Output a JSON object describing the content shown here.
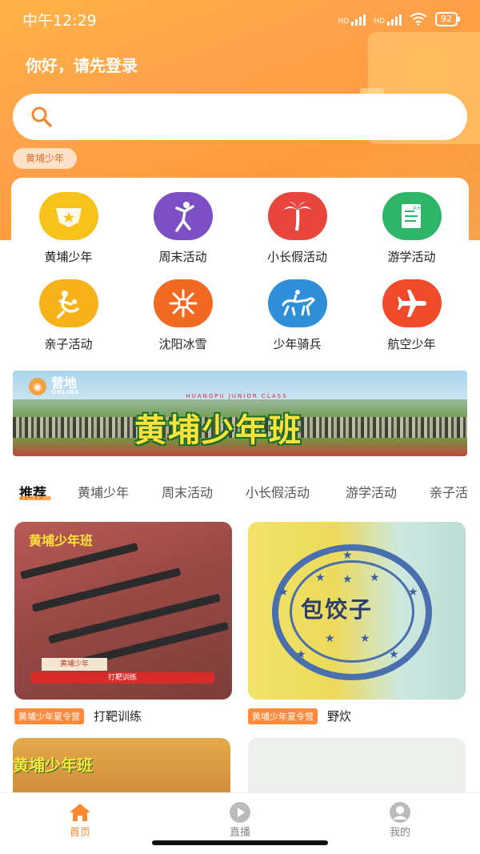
{
  "status": {
    "time": "中午12:29",
    "signal1": "HD",
    "signal2": "HD",
    "battery": "92"
  },
  "header": {
    "greeting": "你好，请先登录"
  },
  "search": {
    "placeholder": ""
  },
  "location_chip": "黄埔少年",
  "categories": [
    {
      "label": "黄埔少年",
      "icon": "badge-icon",
      "color": "#f7c21a"
    },
    {
      "label": "周末活动",
      "icon": "dancer-icon",
      "color": "#7c4fc5"
    },
    {
      "label": "小长假活动",
      "icon": "palm-tree-icon",
      "color": "#e8453c"
    },
    {
      "label": "游学活动",
      "icon": "certificate-icon",
      "color": "#2fb56a"
    },
    {
      "label": "亲子活动",
      "icon": "family-icon",
      "color": "#f7b21a"
    },
    {
      "label": "沈阳冰雪",
      "icon": "snowflake-icon",
      "color": "#f26a22"
    },
    {
      "label": "少年骑兵",
      "icon": "horse-rider-icon",
      "color": "#2f8fd8"
    },
    {
      "label": "航空少年",
      "icon": "airplane-icon",
      "color": "#f04a2a"
    }
  ],
  "banner": {
    "logo_text": "营地",
    "logo_sub": "ONLINE",
    "title": "黄埔少年班",
    "subtitle": "HUANGPU JUNIOR CLASS"
  },
  "tabs": [
    "推荐",
    "黄埔少年",
    "周末活动",
    "小长假活动",
    "游学活动",
    "亲子活"
  ],
  "cards": [
    {
      "image_caption": "黄埔少年班",
      "image_tag": "黄埔少年",
      "image_bar": "打靶训练",
      "tag": "黄埔少年夏令营",
      "title": "打靶训练"
    },
    {
      "image_caption": "包饺子",
      "tag": "黄埔少年夏令营",
      "title": "野炊"
    }
  ],
  "peek_card": {
    "caption": "黄埔少年班"
  },
  "nav": [
    {
      "label": "首页",
      "icon": "home-icon",
      "active": true
    },
    {
      "label": "直播",
      "icon": "play-icon",
      "active": false
    },
    {
      "label": "我的",
      "icon": "user-icon",
      "active": false
    }
  ],
  "colors": {
    "accent": "#ff8a2e",
    "header": "#ffa24a",
    "tag_bg": "#ff8a3a"
  }
}
